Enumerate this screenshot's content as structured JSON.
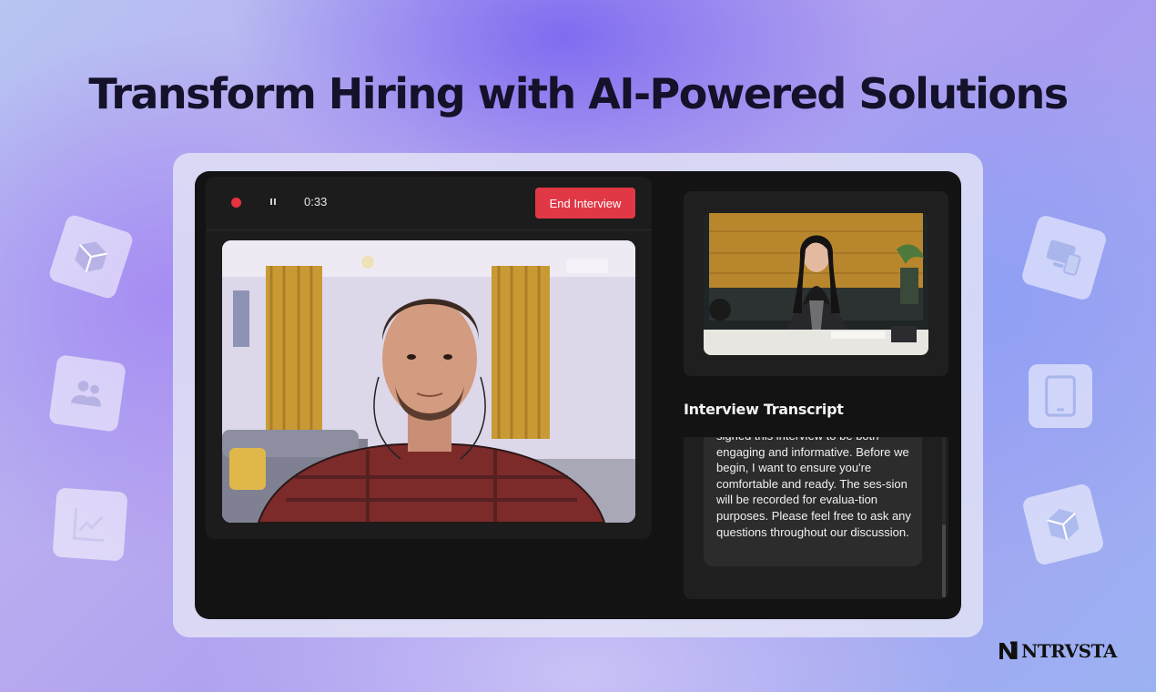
{
  "headline": "Transform Hiring with AI-Powered Solutions",
  "toolbar": {
    "timer": "0:33",
    "end_button_label": "End Interview",
    "record_color": "#e8323f",
    "end_button_color": "#e13846"
  },
  "transcript": {
    "title": "Interview Transcript",
    "message": "signed this interview to be both engaging and informative. Before we begin, I want to ensure you're comfortable and ready. The ses-sion will be recorded for evalua-tion purposes. Please feel free to ask any questions throughout our discussion."
  },
  "brand": {
    "name": "NTRVSTA"
  },
  "decorations": {
    "left_icons": [
      "box-icon",
      "users-icon",
      "line-chart-icon"
    ],
    "right_icons": [
      "devices-icon",
      "tablet-icon",
      "box-icon"
    ]
  },
  "colors": {
    "screen_background": "#131313",
    "panel_background": "#1c1c1c"
  }
}
